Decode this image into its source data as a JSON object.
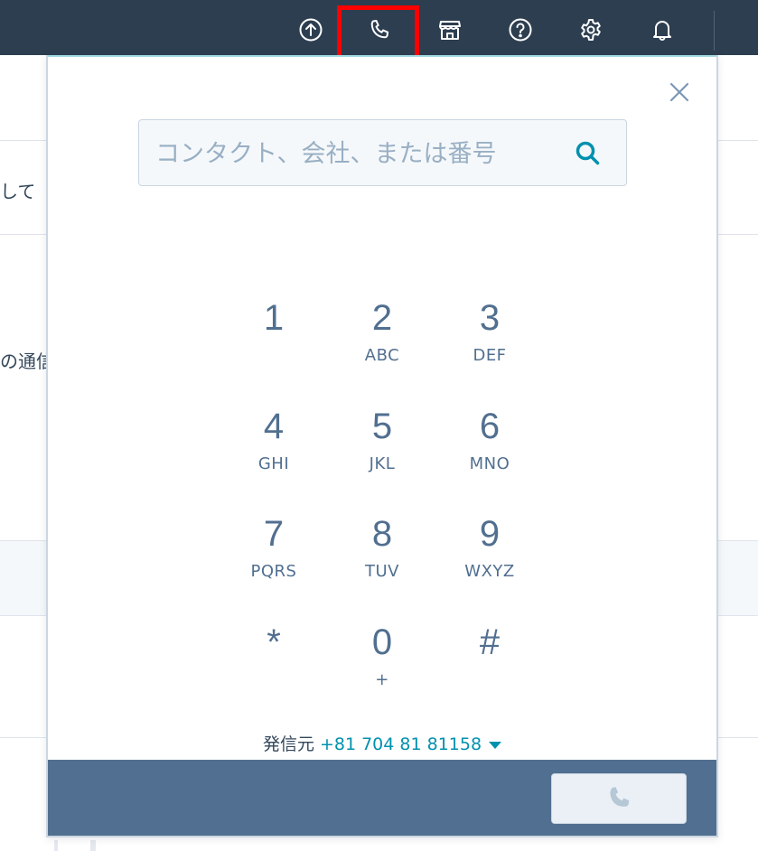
{
  "topbar": {
    "icons": [
      "upgrade-icon",
      "calling-icon",
      "marketplace-icon",
      "help-icon",
      "settings-icon",
      "notifications-icon"
    ]
  },
  "background": {
    "text_1": "して",
    "text_2": "の通信"
  },
  "dialer": {
    "search_placeholder": "コンタクト、会社、または番号",
    "keys": [
      {
        "digit": "1",
        "letters": ""
      },
      {
        "digit": "2",
        "letters": "ABC"
      },
      {
        "digit": "3",
        "letters": "DEF"
      },
      {
        "digit": "4",
        "letters": "GHI"
      },
      {
        "digit": "5",
        "letters": "JKL"
      },
      {
        "digit": "6",
        "letters": "MNO"
      },
      {
        "digit": "7",
        "letters": "PQRS"
      },
      {
        "digit": "8",
        "letters": "TUV"
      },
      {
        "digit": "9",
        "letters": "WXYZ"
      },
      {
        "digit": "*",
        "letters": ""
      },
      {
        "digit": "0",
        "letters": "+"
      },
      {
        "digit": "#",
        "letters": ""
      }
    ],
    "from_label": "発信元",
    "from_number": "+81 704 81 81158",
    "call_button_state": "disabled"
  },
  "colors": {
    "nav_bg": "#2d3e50",
    "accent": "#0091ae",
    "footer_bg": "#516f90",
    "highlight": "#ff0000"
  }
}
